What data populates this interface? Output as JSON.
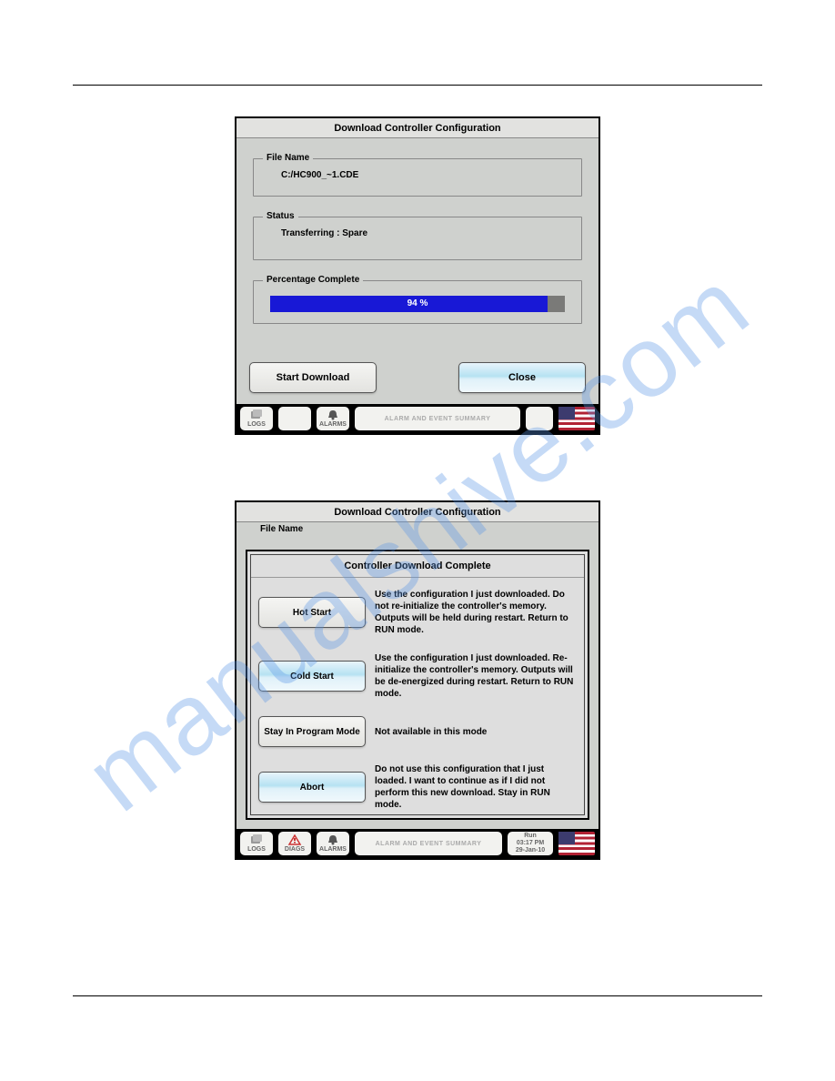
{
  "watermark": "manualshive.com",
  "panel1": {
    "title": "Download Controller Configuration",
    "file_name_legend": "File Name",
    "file_name_value": "C:/HC900_~1.CDE",
    "status_legend": "Status",
    "status_value": "Transferring :   Spare",
    "pct_legend": "Percentage Complete",
    "pct_text": "94 %",
    "start_btn": "Start Download",
    "close_btn": "Close",
    "bar": {
      "logs": "LOGS",
      "alarms": "ALARMS",
      "summary": "ALARM AND EVENT SUMMARY"
    }
  },
  "panel2": {
    "title": "Download Controller Configuration",
    "file_name_legend": "File Name",
    "dialog_title": "Controller Download Complete",
    "opts": [
      {
        "btn": "Hot Start",
        "hl": false,
        "desc": "Use the configuration I just downloaded.  Do not re-initialize the controller's memory.  Outputs will be held during restart.  Return to RUN mode."
      },
      {
        "btn": "Cold Start",
        "hl": true,
        "desc": "Use the configuration I just downloaded.  Re-initialize the controller's memory.  Outputs will be de-energized during restart.  Return to RUN mode."
      },
      {
        "btn": "Stay In Program Mode",
        "hl": false,
        "desc": "Not available in this mode"
      },
      {
        "btn": "Abort",
        "hl": true,
        "desc": "Do not use this configuration that I just loaded.  I want to continue as if I did not perform this new download.  Stay in RUN mode."
      }
    ],
    "bar": {
      "logs": "LOGS",
      "diags": "DIAGS",
      "alarms": "ALARMS",
      "summary": "ALARM AND EVENT SUMMARY",
      "mode": "Run",
      "time": "03:17 PM",
      "date": "29-Jan-10"
    }
  }
}
